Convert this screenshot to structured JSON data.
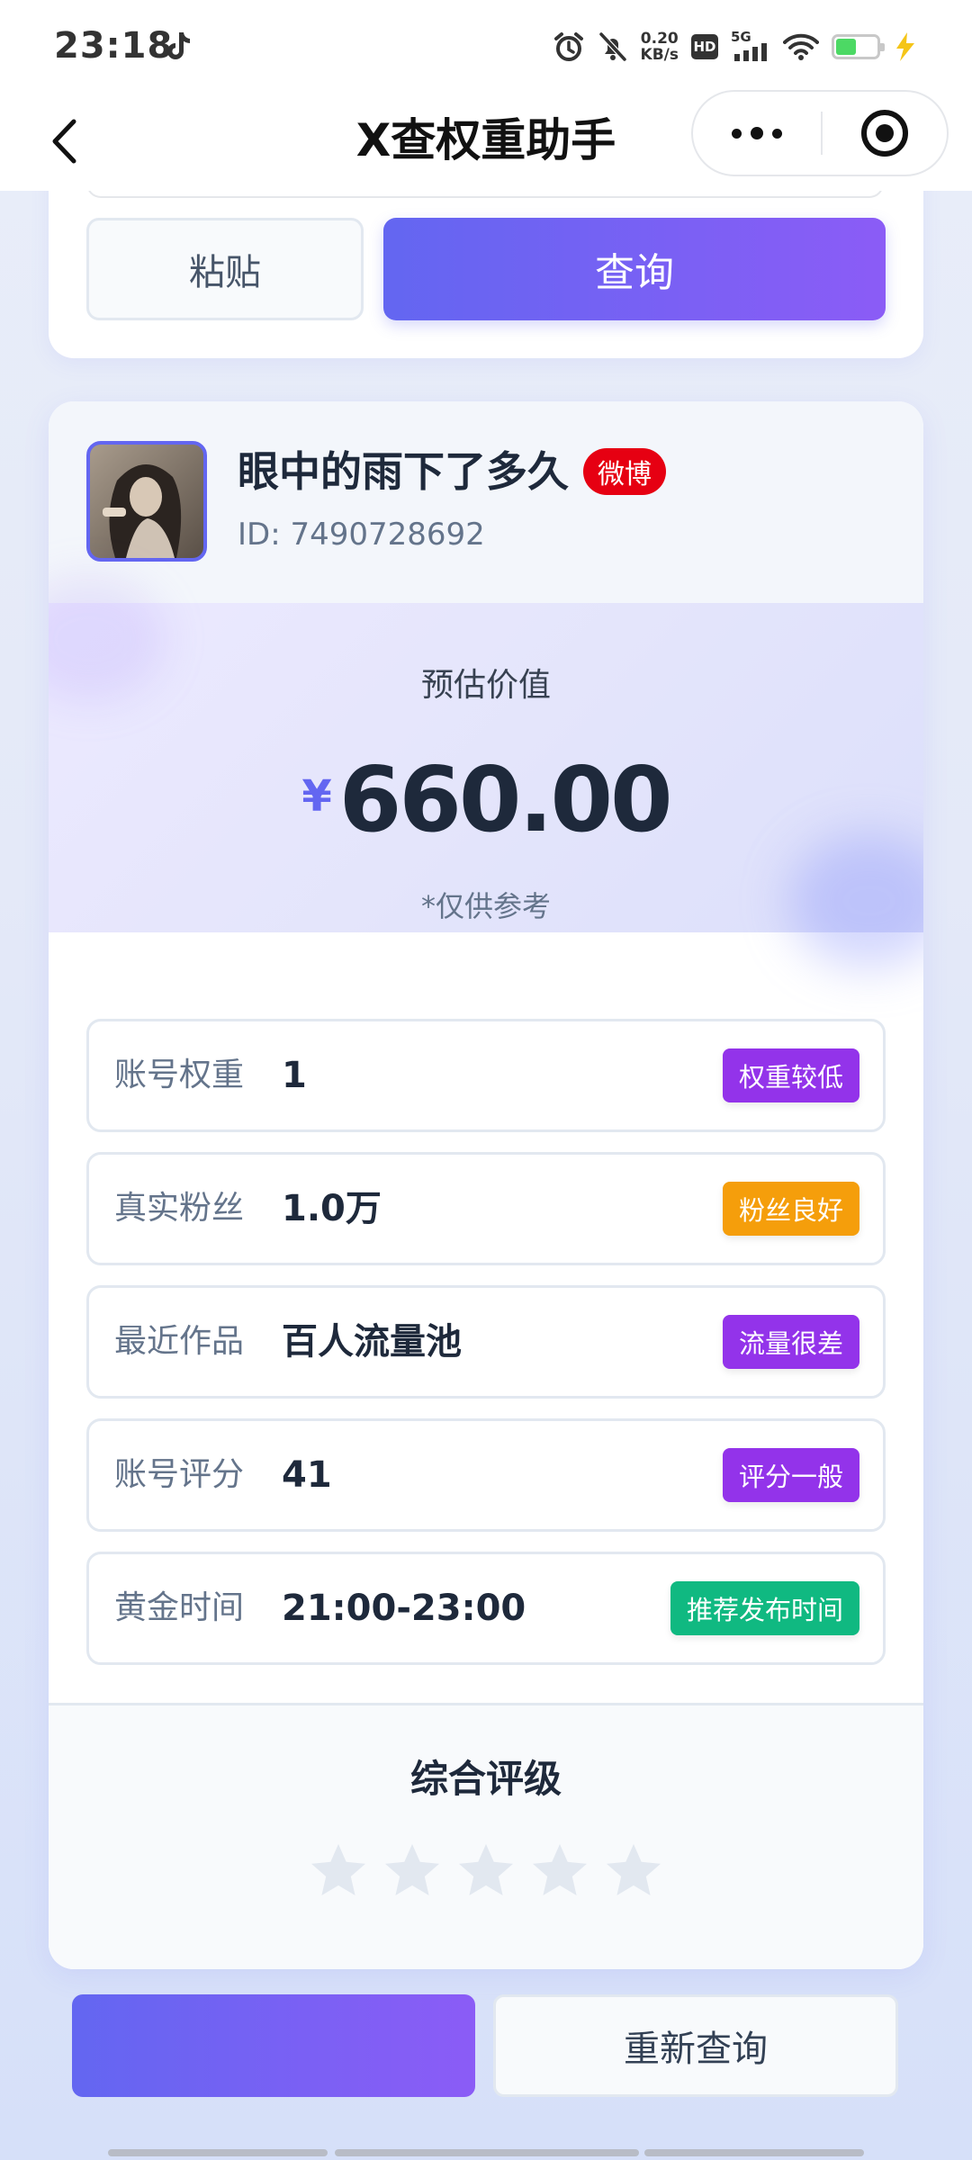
{
  "status_bar": {
    "time": "23:18",
    "net_speed_value": "0.20",
    "net_speed_unit": "KB/s",
    "hd": "HD",
    "network": "5G",
    "icons": [
      "tiktok-icon",
      "alarm-icon",
      "mute-icon",
      "signal-icon",
      "wifi-icon",
      "battery-icon",
      "charging-icon"
    ]
  },
  "nav": {
    "title": "X查权重助手"
  },
  "search": {
    "paste_label": "粘贴",
    "query_label": "查询"
  },
  "profile": {
    "name": "眼中的雨下了多久",
    "platform": "微博",
    "id_text": "ID: 7490728692"
  },
  "valuation": {
    "label": "预估价值",
    "currency": "¥",
    "amount": "660.00",
    "note": "*仅供参考"
  },
  "metrics": [
    {
      "label": "账号权重",
      "value": "1",
      "tag": "权重较低",
      "tag_color": "#9333ea"
    },
    {
      "label": "真实粉丝",
      "value": "1.0万",
      "tag": "粉丝良好",
      "tag_color": "#f59e0b"
    },
    {
      "label": "最近作品",
      "value": "百人流量池",
      "tag": "流量很差",
      "tag_color": "#9333ea"
    },
    {
      "label": "账号评分",
      "value": "41",
      "tag": "评分一般",
      "tag_color": "#9333ea"
    },
    {
      "label": "黄金时间",
      "value": "21:00-23:00",
      "tag": "推荐发布时间",
      "tag_color": "#10b981"
    }
  ],
  "rating": {
    "title": "综合评级",
    "stars_total": 5,
    "stars_filled": 0
  },
  "actions": {
    "secondary_label": "重新查询"
  },
  "colors": {
    "accent_start": "#6366f1",
    "accent_end": "#8b5cf6",
    "weibo_red": "#e60012"
  }
}
